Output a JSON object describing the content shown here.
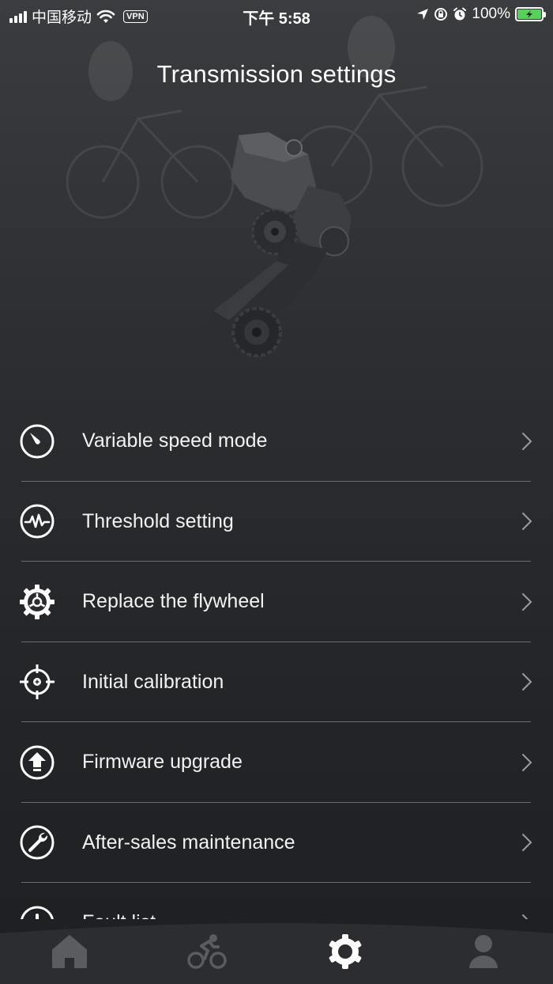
{
  "status_bar": {
    "carrier": "中国移动",
    "vpn": "VPN",
    "time": "下午 5:58",
    "battery": "100%"
  },
  "page": {
    "title": "Transmission settings"
  },
  "menu": {
    "items": [
      {
        "label": "Variable speed mode",
        "icon": "speedometer-icon"
      },
      {
        "label": "Threshold setting",
        "icon": "waveform-icon"
      },
      {
        "label": "Replace the flywheel",
        "icon": "gear-icon"
      },
      {
        "label": "Initial calibration",
        "icon": "crosshair-icon"
      },
      {
        "label": "Firmware upgrade",
        "icon": "upload-icon"
      },
      {
        "label": "After-sales maintenance",
        "icon": "wrench-icon"
      },
      {
        "label": "Fault list",
        "icon": "alert-icon"
      }
    ]
  },
  "tab_bar": {
    "tabs": [
      {
        "name": "home",
        "icon": "home-icon",
        "active": false
      },
      {
        "name": "ride",
        "icon": "cyclist-icon",
        "active": false
      },
      {
        "name": "settings",
        "icon": "settings-gear-icon",
        "active": true
      },
      {
        "name": "profile",
        "icon": "person-icon",
        "active": false
      }
    ]
  },
  "colors": {
    "background_top": "#3a3c40",
    "background_bottom": "#1d1f22",
    "divider": "#6a6c70",
    "tab_inactive": "#5a5c60",
    "tab_active": "#ffffff",
    "battery_fill": "#56d25a"
  }
}
